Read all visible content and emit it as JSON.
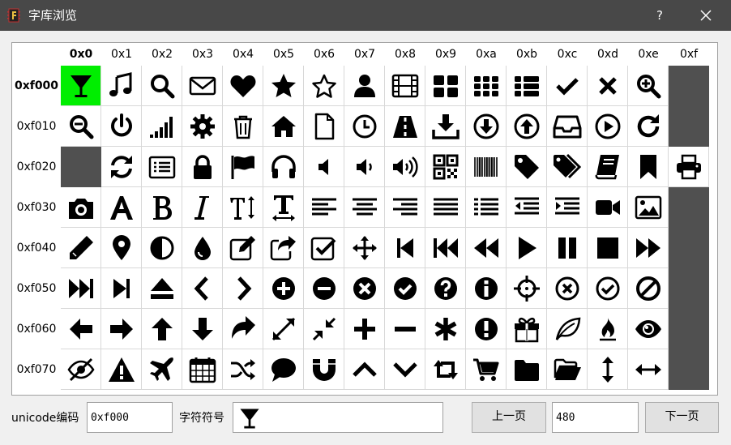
{
  "window": {
    "title": "字库浏览",
    "help_label": "?"
  },
  "grid": {
    "columns": [
      "0x0",
      "0x1",
      "0x2",
      "0x3",
      "0x4",
      "0x5",
      "0x6",
      "0x7",
      "0x8",
      "0x9",
      "0xa",
      "0xb",
      "0xc",
      "0xd",
      "0xe",
      "0xf"
    ],
    "rows": [
      {
        "label": "0xf000",
        "icons": [
          "glass",
          "music",
          "search",
          "envelope",
          "heart",
          "star",
          "star-o",
          "user",
          "film",
          "th-large",
          "th",
          "th-list",
          "check",
          "times",
          "search-plus",
          ""
        ]
      },
      {
        "label": "0xf010",
        "icons": [
          "search-minus",
          "power-off",
          "signal",
          "cog",
          "trash",
          "home",
          "file-o",
          "clock",
          "road",
          "download",
          "arrow-circle-down",
          "arrow-circle-up",
          "inbox",
          "play-circle",
          "repeat",
          ""
        ]
      },
      {
        "label": "0xf020",
        "icons": [
          "",
          "refresh",
          "list-alt",
          "lock",
          "flag",
          "headphones",
          "volume-off",
          "volume-down",
          "volume-up",
          "qrcode",
          "barcode",
          "tag",
          "tags",
          "book",
          "bookmark",
          "print"
        ]
      },
      {
        "label": "0xf030",
        "icons": [
          "camera",
          "font",
          "bold",
          "italic",
          "text-height",
          "text-width",
          "align-left",
          "align-center",
          "align-right",
          "align-justify",
          "list",
          "outdent",
          "indent",
          "video-camera",
          "picture",
          ""
        ]
      },
      {
        "label": "0xf040",
        "icons": [
          "pencil",
          "map-marker",
          "adjust",
          "tint",
          "edit",
          "share-square",
          "check-square",
          "arrows",
          "step-backward",
          "fast-backward",
          "backward",
          "play",
          "pause",
          "stop",
          "forward",
          ""
        ]
      },
      {
        "label": "0xf050",
        "icons": [
          "fast-forward",
          "step-forward",
          "eject",
          "chevron-left",
          "chevron-right",
          "plus-circle",
          "minus-circle",
          "times-circle",
          "check-circle",
          "question-circle",
          "info-circle",
          "crosshairs",
          "times-circle-o",
          "check-circle-o",
          "ban",
          ""
        ]
      },
      {
        "label": "0xf060",
        "icons": [
          "arrow-left",
          "arrow-right",
          "arrow-up",
          "arrow-down",
          "mail-forward",
          "expand",
          "compress",
          "plus",
          "minus",
          "asterisk",
          "exclamation-circle",
          "gift",
          "leaf",
          "fire",
          "eye",
          ""
        ]
      },
      {
        "label": "0xf070",
        "icons": [
          "eye-slash",
          "warning",
          "plane",
          "calendar",
          "random",
          "comment",
          "magnet",
          "chevron-up",
          "chevron-down",
          "retweet",
          "shopping-cart",
          "folder",
          "folder-open",
          "arrows-v",
          "arrows-h",
          ""
        ]
      }
    ],
    "selected": {
      "row": 0,
      "col": 0
    }
  },
  "footer": {
    "unicode_label": "unicode编码",
    "unicode_value": "0xf000",
    "symbol_label": "字符符号",
    "symbol_icon": "glass",
    "prev_label": "上一页",
    "page_value": "480",
    "next_label": "下一页"
  },
  "colors": {
    "titlebar": "#484848",
    "selected_cell": "#00ee00",
    "empty_cell": "#505050"
  }
}
